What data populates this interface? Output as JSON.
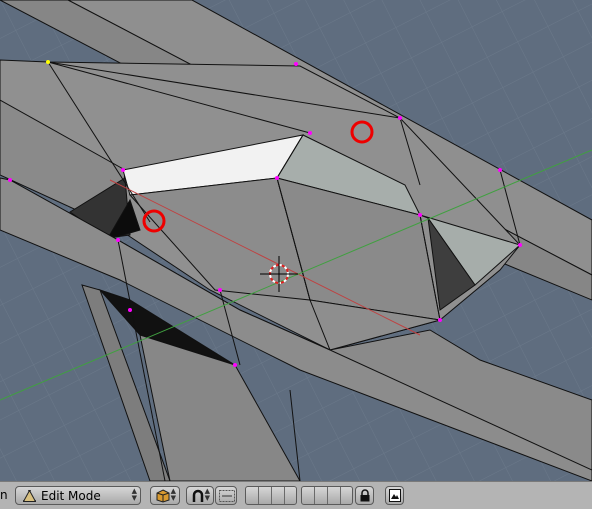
{
  "viewport": {
    "name": "3D viewport",
    "colors": {
      "background": "#5f6d7f",
      "face": "#909090",
      "edge": "#000000",
      "vertex": "#ff00ff",
      "highlight": "#ff0000"
    }
  },
  "header": {
    "truncated_left_text": "n",
    "mode_menu": {
      "label": "Edit Mode",
      "icon": "edit-mode-triangle-icon"
    },
    "draw_type_icon": "cube-shading-icon",
    "pivot_icon": "horseshoe-pivot-icon",
    "manipulator_icon": "manipulator-icon",
    "lock_icon": "lock-icon",
    "render_icon": "render-preview-icon"
  }
}
